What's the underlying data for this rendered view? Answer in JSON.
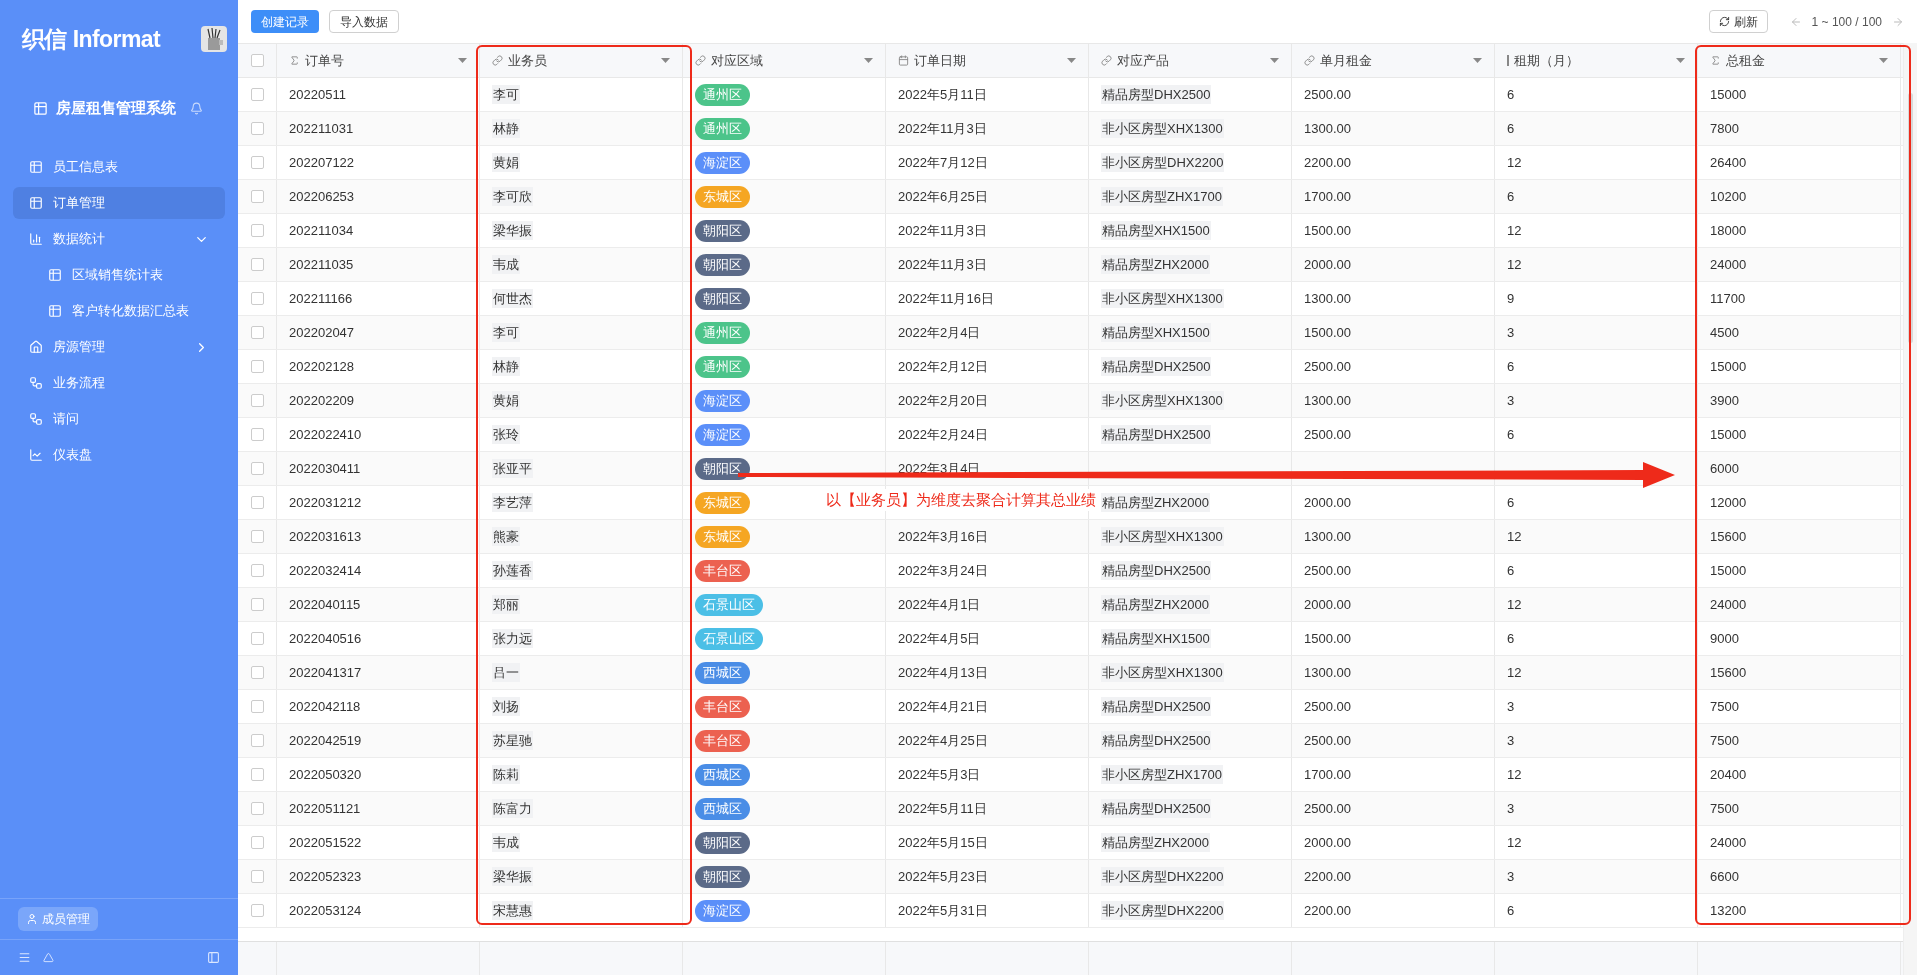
{
  "sidebar": {
    "logo": "织信 Informat",
    "app_title": "房屋租售管理系统",
    "items": [
      {
        "label": "员工信息表",
        "kind": "table",
        "selected": false
      },
      {
        "label": "订单管理",
        "kind": "table",
        "selected": true
      },
      {
        "label": "数据统计",
        "kind": "chart",
        "selected": false,
        "expanded": true,
        "children": [
          {
            "label": "区域销售统计表",
            "kind": "table",
            "selected": false
          },
          {
            "label": "客户转化数据汇总表",
            "kind": "table",
            "selected": false
          }
        ]
      },
      {
        "label": "房源管理",
        "kind": "home",
        "selected": false,
        "expanded": false
      },
      {
        "label": "业务流程",
        "kind": "flow",
        "selected": false
      },
      {
        "label": "请问",
        "kind": "flow",
        "selected": false
      },
      {
        "label": "仪表盘",
        "kind": "dashboard",
        "selected": false
      }
    ],
    "member_button": "成员管理"
  },
  "toolbar": {
    "create_button": "创建记录",
    "import_button": "导入数据",
    "refresh_button": "刷新",
    "pagination": "1 ~ 100 / 100"
  },
  "table": {
    "header_checked": false,
    "columns": [
      {
        "label": "订单号",
        "kind": "sum"
      },
      {
        "label": "业务员",
        "kind": "link"
      },
      {
        "label": "对应区域",
        "kind": "link"
      },
      {
        "label": "订单日期",
        "kind": "date"
      },
      {
        "label": "对应产品",
        "kind": "link"
      },
      {
        "label": "单月租金",
        "kind": "link"
      },
      {
        "label": "租期（月）",
        "kind": "number"
      },
      {
        "label": "总租金",
        "kind": "sum"
      }
    ],
    "rows": [
      {
        "checked": false,
        "order": "20220511",
        "agent": "李可",
        "region": {
          "label": "通州区",
          "color": "#4cc48a"
        },
        "date": "2022年5月11日",
        "product": "精品房型DHX2500",
        "monthly": "2500.00",
        "term": "6",
        "total": "15000"
      },
      {
        "checked": false,
        "order": "202211031",
        "agent": "林静",
        "region": {
          "label": "通州区",
          "color": "#4cc48a"
        },
        "date": "2022年11月3日",
        "product": "非小区房型XHX1300",
        "monthly": "1300.00",
        "term": "6",
        "total": "7800"
      },
      {
        "checked": false,
        "order": "202207122",
        "agent": "黄娟",
        "region": {
          "label": "海淀区",
          "color": "#5b8ff9"
        },
        "date": "2022年7月12日",
        "product": "非小区房型DHX2200",
        "monthly": "2200.00",
        "term": "12",
        "total": "26400"
      },
      {
        "checked": false,
        "order": "202206253",
        "agent": "李可欣",
        "region": {
          "label": "东城区",
          "color": "#f5a623"
        },
        "date": "2022年6月25日",
        "product": "非小区房型ZHX1700",
        "monthly": "1700.00",
        "term": "6",
        "total": "10200"
      },
      {
        "checked": false,
        "order": "202211034",
        "agent": "梁华振",
        "region": {
          "label": "朝阳区",
          "color": "#5b6a88"
        },
        "date": "2022年11月3日",
        "product": "精品房型XHX1500",
        "monthly": "1500.00",
        "term": "12",
        "total": "18000"
      },
      {
        "checked": false,
        "order": "202211035",
        "agent": "韦成",
        "region": {
          "label": "朝阳区",
          "color": "#5b6a88"
        },
        "date": "2022年11月3日",
        "product": "精品房型ZHX2000",
        "monthly": "2000.00",
        "term": "12",
        "total": "24000"
      },
      {
        "checked": false,
        "order": "202211166",
        "agent": "何世杰",
        "region": {
          "label": "朝阳区",
          "color": "#5b6a88"
        },
        "date": "2022年11月16日",
        "product": "非小区房型XHX1300",
        "monthly": "1300.00",
        "term": "9",
        "total": "11700"
      },
      {
        "checked": false,
        "order": "202202047",
        "agent": "李可",
        "region": {
          "label": "通州区",
          "color": "#4cc48a"
        },
        "date": "2022年2月4日",
        "product": "精品房型XHX1500",
        "monthly": "1500.00",
        "term": "3",
        "total": "4500"
      },
      {
        "checked": false,
        "order": "202202128",
        "agent": "林静",
        "region": {
          "label": "通州区",
          "color": "#4cc48a"
        },
        "date": "2022年2月12日",
        "product": "精品房型DHX2500",
        "monthly": "2500.00",
        "term": "6",
        "total": "15000"
      },
      {
        "checked": false,
        "order": "202202209",
        "agent": "黄娟",
        "region": {
          "label": "海淀区",
          "color": "#5b8ff9"
        },
        "date": "2022年2月20日",
        "product": "非小区房型XHX1300",
        "monthly": "1300.00",
        "term": "3",
        "total": "3900"
      },
      {
        "checked": false,
        "order": "2022022410",
        "agent": "张玲",
        "region": {
          "label": "海淀区",
          "color": "#5b8ff9"
        },
        "date": "2022年2月24日",
        "product": "精品房型DHX2500",
        "monthly": "2500.00",
        "term": "6",
        "total": "15000"
      },
      {
        "checked": false,
        "order": "2022030411",
        "agent": "张亚平",
        "region": {
          "label": "朝阳区",
          "color": "#5b6a88"
        },
        "date": "2022年3月4日",
        "total": "6000"
      },
      {
        "checked": false,
        "order": "2022031212",
        "agent": "李艺萍",
        "region": {
          "label": "东城区",
          "color": "#f5a623"
        },
        "product": "精品房型ZHX2000",
        "monthly": "2000.00",
        "term": "6",
        "total": "12000"
      },
      {
        "checked": false,
        "order": "2022031613",
        "agent": "熊豪",
        "region": {
          "label": "东城区",
          "color": "#f5a623"
        },
        "date": "2022年3月16日",
        "product": "非小区房型XHX1300",
        "monthly": "1300.00",
        "term": "12",
        "total": "15600"
      },
      {
        "checked": false,
        "order": "2022032414",
        "agent": "孙莲香",
        "region": {
          "label": "丰台区",
          "color": "#ec6150"
        },
        "date": "2022年3月24日",
        "product": "精品房型DHX2500",
        "monthly": "2500.00",
        "term": "6",
        "total": "15000"
      },
      {
        "checked": false,
        "order": "2022040115",
        "agent": "郑丽",
        "region": {
          "label": "石景山区",
          "color": "#4bbfe6"
        },
        "date": "2022年4月1日",
        "product": "精品房型ZHX2000",
        "monthly": "2000.00",
        "term": "12",
        "total": "24000"
      },
      {
        "checked": false,
        "order": "2022040516",
        "agent": "张力远",
        "region": {
          "label": "石景山区",
          "color": "#4bbfe6"
        },
        "date": "2022年4月5日",
        "product": "精品房型XHX1500",
        "monthly": "1500.00",
        "term": "6",
        "total": "9000"
      },
      {
        "checked": false,
        "order": "2022041317",
        "agent": "吕一",
        "region": {
          "label": "西城区",
          "color": "#4a8de6"
        },
        "date": "2022年4月13日",
        "product": "非小区房型XHX1300",
        "monthly": "1300.00",
        "term": "12",
        "total": "15600"
      },
      {
        "checked": false,
        "order": "2022042118",
        "agent": "刘扬",
        "region": {
          "label": "丰台区",
          "color": "#ec6150"
        },
        "date": "2022年4月21日",
        "product": "精品房型DHX2500",
        "monthly": "2500.00",
        "term": "3",
        "total": "7500"
      },
      {
        "checked": false,
        "order": "2022042519",
        "agent": "苏星驰",
        "region": {
          "label": "丰台区",
          "color": "#ec6150"
        },
        "date": "2022年4月25日",
        "product": "精品房型DHX2500",
        "monthly": "2500.00",
        "term": "3",
        "total": "7500"
      },
      {
        "checked": false,
        "order": "2022050320",
        "agent": "陈莉",
        "region": {
          "label": "西城区",
          "color": "#4a8de6"
        },
        "date": "2022年5月3日",
        "product": "非小区房型ZHX1700",
        "monthly": "1700.00",
        "term": "12",
        "total": "20400"
      },
      {
        "checked": false,
        "order": "2022051121",
        "agent": "陈富力",
        "region": {
          "label": "西城区",
          "color": "#4a8de6"
        },
        "date": "2022年5月11日",
        "product": "精品房型DHX2500",
        "monthly": "2500.00",
        "term": "3",
        "total": "7500"
      },
      {
        "checked": false,
        "order": "2022051522",
        "agent": "韦成",
        "region": {
          "label": "朝阳区",
          "color": "#5b6a88"
        },
        "date": "2022年5月15日",
        "product": "精品房型ZHX2000",
        "monthly": "2000.00",
        "term": "12",
        "total": "24000"
      },
      {
        "checked": false,
        "order": "2022052323",
        "agent": "梁华振",
        "region": {
          "label": "朝阳区",
          "color": "#5b6a88"
        },
        "date": "2022年5月23日",
        "product": "非小区房型DHX2200",
        "monthly": "2200.00",
        "term": "3",
        "total": "6600"
      },
      {
        "checked": false,
        "order": "2022053124",
        "agent": "宋慧惠",
        "region": {
          "label": "海淀区",
          "color": "#5b8ff9"
        },
        "date": "2022年5月31日",
        "product": "非小区房型DHX2200",
        "monthly": "2200.00",
        "term": "6",
        "total": "13200"
      }
    ]
  },
  "annotation": {
    "text": "以【业务员】为维度去聚合计算其总业绩"
  }
}
